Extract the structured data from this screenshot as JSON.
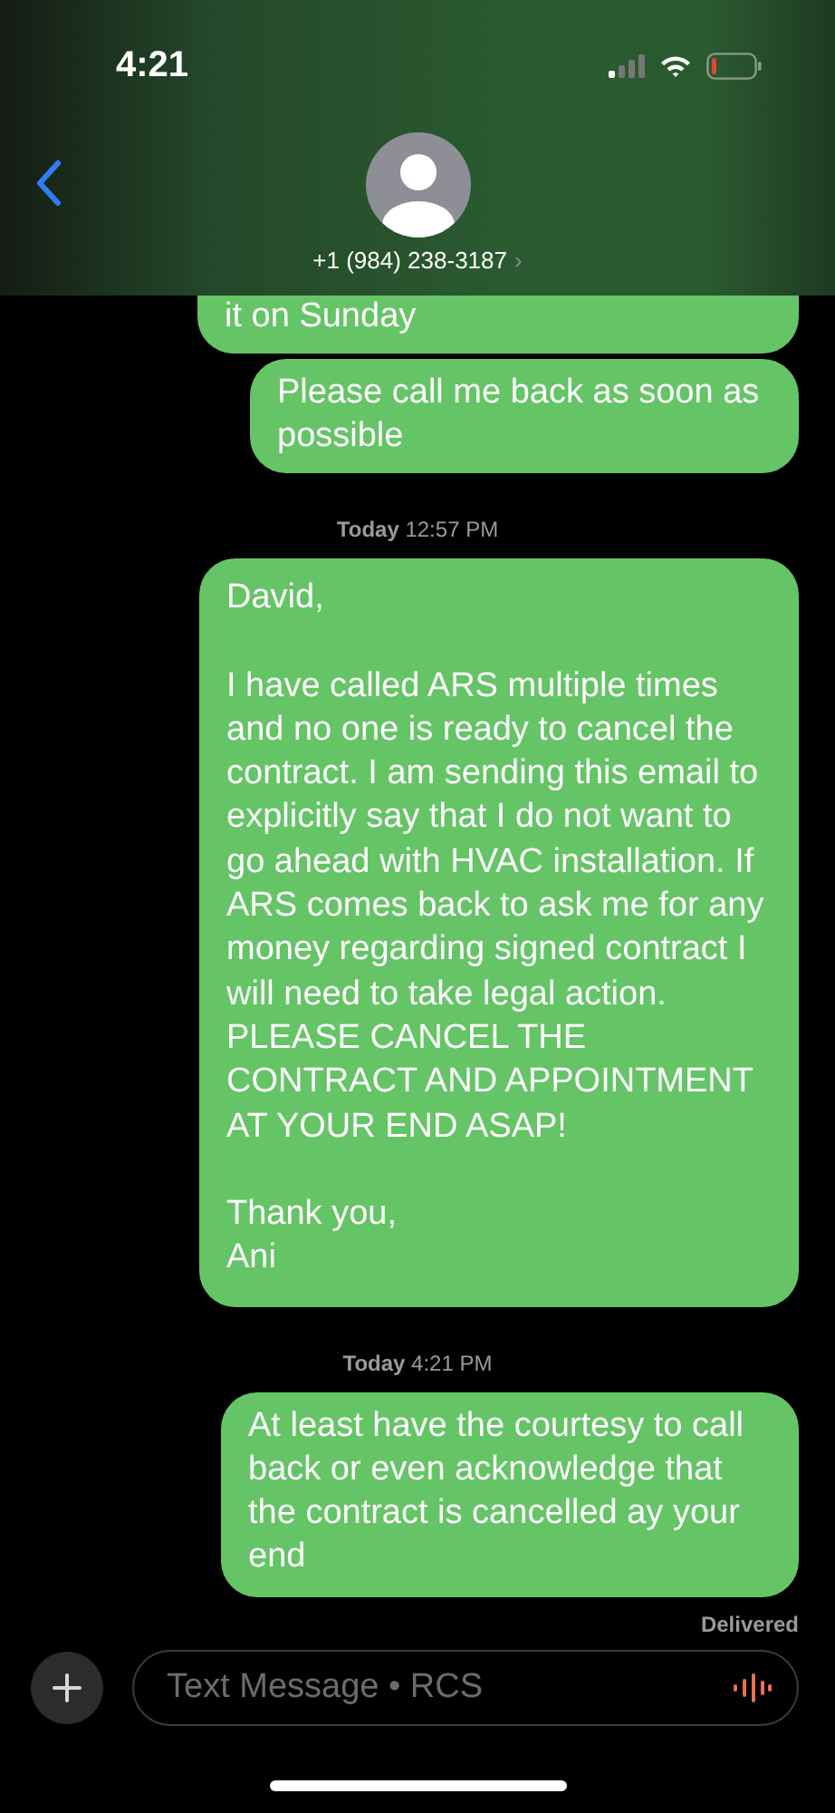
{
  "status_bar": {
    "time": "4:21"
  },
  "header": {
    "contact": "+1 (984) 238-3187",
    "chevron": "›"
  },
  "messages": [
    {
      "kind": "bubble",
      "text": "it on Sunday",
      "cut": true
    },
    {
      "kind": "bubble",
      "text": "Please call me back as soon as possible",
      "cut": false
    },
    {
      "kind": "timestamp",
      "day": "Today",
      "time": "12:57 PM"
    },
    {
      "kind": "bubble",
      "text": "David,\n\nI have called ARS multiple times and no one is ready to cancel the contract. I am sending this email to explicitly say that I do not want to go ahead with HVAC installation. If ARS comes back to ask me for any money regarding signed contract I will need to take legal action. PLEASE CANCEL THE CONTRACT AND APPOINTMENT AT YOUR END ASAP!\n\nThank you,\nAni",
      "cut": false
    },
    {
      "kind": "timestamp",
      "day": "Today",
      "time": "4:21 PM"
    },
    {
      "kind": "bubble",
      "text": "At least have the courtesy to call back or even acknowledge that the contract is cancelled ay your end",
      "cut": false
    }
  ],
  "delivery_status": "Delivered",
  "composer": {
    "placeholder": "Text Message • RCS"
  }
}
